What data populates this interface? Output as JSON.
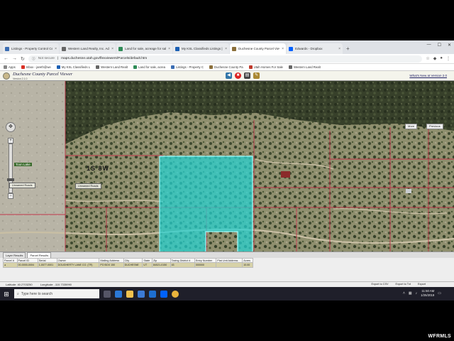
{
  "browser": {
    "tabs": [
      {
        "label": "Listings - Property Control Cente",
        "color": "#3b6db3",
        "active": false
      },
      {
        "label": "Western Land Realty, Inc. Admin",
        "color": "#666666",
        "active": false
      },
      {
        "label": "Land for sale, acreage for sale, U",
        "color": "#2e8b57",
        "active": false
      },
      {
        "label": "My KSL Classifieds Listings | ksl",
        "color": "#1a5fb4",
        "active": false
      },
      {
        "label": "Duchesne County Parcel Viewer",
        "color": "#8b6f3a",
        "active": true
      },
      {
        "label": "Edwards - Dropbox",
        "color": "#0061fe",
        "active": false
      }
    ],
    "new_tab": "+",
    "secure_label": "Not secure",
    "url": "maps.duchesne.utah.gov/flexviewers/Parcels/default.htm",
    "bookmarks": [
      {
        "label": "Apps",
        "color": "#888888"
      },
      {
        "label": "Inbox - jareth@we",
        "color": "#d93025"
      },
      {
        "label": "My KSL Classifieds L",
        "color": "#1a5fb4"
      },
      {
        "label": "Western Land Realt",
        "color": "#666666"
      },
      {
        "label": "Land for sale, acrea",
        "color": "#2e8b57"
      },
      {
        "label": "Listings - Property C",
        "color": "#3b6db3"
      },
      {
        "label": "Duchesne County Pa",
        "color": "#8b6f3a"
      },
      {
        "label": "Utah Homes For Sale",
        "color": "#c0392b"
      },
      {
        "label": "Western Land Realt",
        "color": "#666666"
      }
    ]
  },
  "app": {
    "title": "Duchesne County Parcel Viewer",
    "version": "Version 2.1.0",
    "whats_new": "What's New at Version 2.0"
  },
  "map": {
    "township_label": "1S 8W",
    "green_label": "Toon Lake",
    "tag_left": "Unnamed Roads",
    "tag_right": "Unnamed Roads",
    "btn_more": "More",
    "btn_previous": "Previous",
    "highlight_color": "#22d3d3"
  },
  "results": {
    "tabs": [
      "Layer Results",
      "Parcel Results"
    ],
    "columns": [
      "Parcel #",
      "Parcel ID",
      "Serial",
      "Owner",
      "Mailing Address",
      "City",
      "State",
      "Zip",
      "Taxing District #",
      "Entry Number",
      "Plat Unit Address",
      "Acres"
    ],
    "rows": [
      [
        "",
        "00-0000-0004",
        "1-0077-0001",
        "DOUGHERTY LANE CO. (TR)",
        "PO BOX 150",
        "DUCHESNE",
        "UT",
        "84021-0150",
        "43",
        "000000",
        "",
        "10.00"
      ]
    ]
  },
  "status": {
    "latitude": "Latitude: 40.2703250",
    "longitude": "Longitude: -110.7335990",
    "report_csv": "Export to CSV",
    "report_txt": "Export to Txt",
    "report_print": "Export"
  },
  "taskbar": {
    "search_placeholder": "Type here to search",
    "time": "11:50 AM",
    "date": "1/25/2019"
  },
  "watermark": "WFRMLS"
}
